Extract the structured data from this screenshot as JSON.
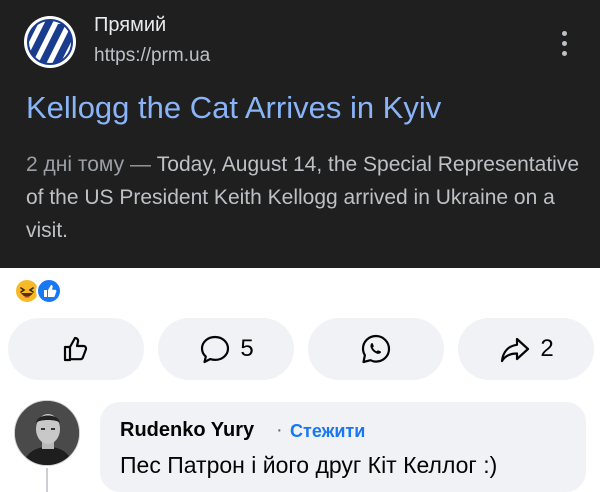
{
  "result": {
    "site_name": "Прямий",
    "site_url": "https://prm.ua",
    "title": "Kellogg the Cat Arrives in Kyiv",
    "date": "2 дні тому",
    "dash": " — ",
    "snippet": "Today, August 14, the Special Representative of the US President Keith Kellogg arrived in Ukraine on a visit."
  },
  "reactions": {
    "icons": [
      "haha-emoji-icon",
      "like-reaction-icon"
    ]
  },
  "actions": {
    "like_icon": "thumbs-up-icon",
    "comment_icon": "comment-bubble-icon",
    "comment_count": "5",
    "whatsapp_icon": "whatsapp-icon",
    "share_icon": "share-arrow-icon",
    "share_count": "2"
  },
  "comment": {
    "author": "Rudenko  Yury",
    "separator": "·",
    "follow_label": "Стежити",
    "text": "Пес Патрон і його друг Кіт Келлог :)"
  },
  "colors": {
    "card_bg": "#1f1f1f",
    "link": "#8ab4f8",
    "facebook_blue": "#1877f2",
    "button_bg": "#f0f2f5"
  }
}
